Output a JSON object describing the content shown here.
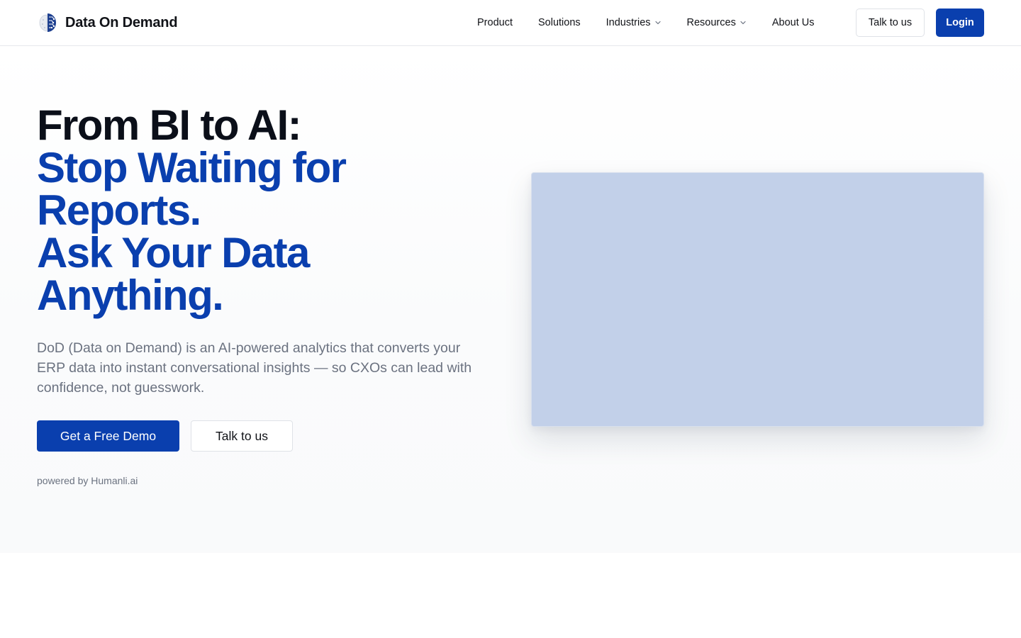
{
  "header": {
    "brand_name": "Data On Demand",
    "nav": [
      {
        "label": "Product",
        "has_dropdown": false
      },
      {
        "label": "Solutions",
        "has_dropdown": false
      },
      {
        "label": "Industries",
        "has_dropdown": true
      },
      {
        "label": "Resources",
        "has_dropdown": true
      },
      {
        "label": "About Us",
        "has_dropdown": false
      }
    ],
    "talk_label": "Talk to us",
    "login_label": "Login"
  },
  "hero": {
    "title_line1": "From BI to AI:",
    "title_line2": "Stop Waiting for",
    "title_line3": "Reports.",
    "title_line4": "Ask Your Data",
    "title_line5": "Anything.",
    "description": "DoD (Data on Demand) is an AI-powered analytics that converts your ERP data into instant conversational insights — so CXOs can lead with confidence, not guesswork.",
    "primary_cta": "Get a Free Demo",
    "secondary_cta": "Talk to us",
    "powered_by": "powered by Humanli.ai"
  },
  "colors": {
    "brand_blue": "#0a3fae",
    "text_dark": "#0b0f19",
    "text_muted": "#6b7280",
    "media_placeholder": "#c2d0e9"
  },
  "icons": {
    "logo": "brain-chip-logo-icon",
    "dropdown": "chevron-down-icon"
  }
}
